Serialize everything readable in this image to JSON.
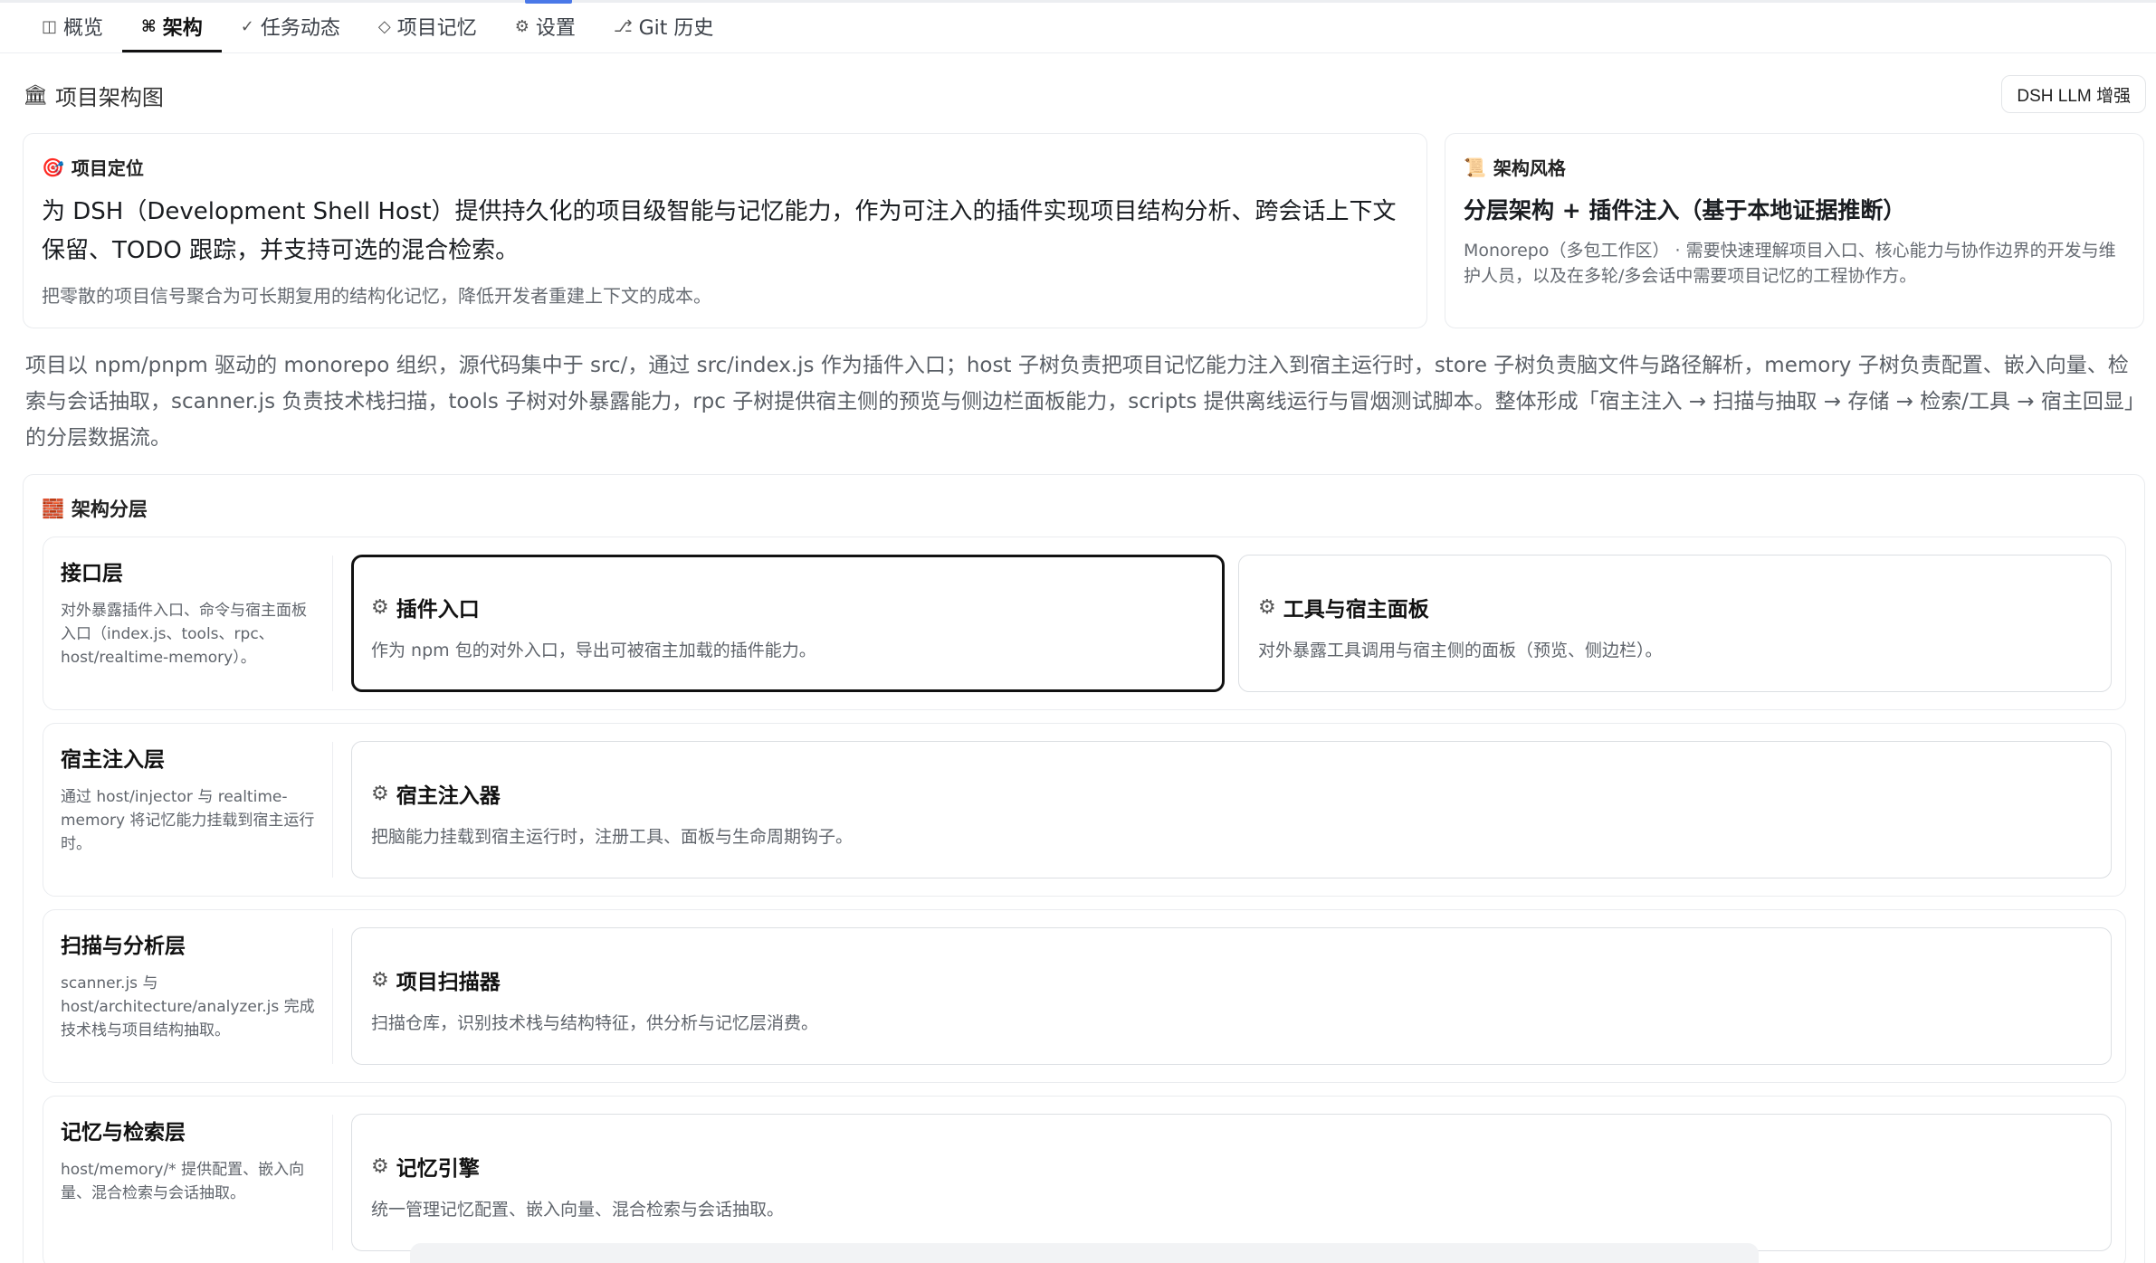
{
  "tabs": [
    {
      "icon": "◫",
      "label": "概览"
    },
    {
      "icon": "⌘",
      "label": "架构"
    },
    {
      "icon": "✓",
      "label": "任务动态"
    },
    {
      "icon": "◇",
      "label": "项目记忆"
    },
    {
      "icon": "⚙",
      "label": "设置"
    },
    {
      "icon": "⎇",
      "label": "Git 历史"
    }
  ],
  "section": {
    "icon": "🏛",
    "title": "项目架构图",
    "llm_button": "DSH LLM 增强"
  },
  "positioning": {
    "icon": "🎯",
    "title": "项目定位",
    "headline": "为 DSH（Development Shell Host）提供持久化的项目级智能与记忆能力，作为可注入的插件实现项目结构分析、跨会话上下文保留、TODO 跟踪，并支持可选的混合检索。",
    "sub": "把零散的项目信号聚合为可长期复用的结构化记忆，降低开发者重建上下文的成本。"
  },
  "style": {
    "icon": "📜",
    "title": "架构风格",
    "headline": "分层架构 + 插件注入（基于本地证据推断）",
    "sub": "Monorepo（多包工作区） · 需要快速理解项目入口、核心能力与协作边界的开发与维护人员，以及在多轮/多会话中需要项目记忆的工程协作方。"
  },
  "summary": "项目以 npm/pnpm 驱动的 monorepo 组织，源代码集中于 src/，通过 src/index.js 作为插件入口；host 子树负责把项目记忆能力注入到宿主运行时，store 子树负责脑文件与路径解析，memory 子树负责配置、嵌入向量、检索与会话抽取，scanner.js 负责技术栈扫描，tools 子树对外暴露能力，rpc 子树提供宿主侧的预览与侧边栏面板能力，scripts 提供离线运行与冒烟测试脚本。整体形成「宿主注入 → 扫描与抽取 → 存储 → 检索/工具 → 宿主回显」的分层数据流。",
  "layers_section": {
    "icon": "🧱",
    "title": "架构分层"
  },
  "layers": [
    {
      "name": "接口层",
      "desc": "对外暴露插件入口、命令与宿主面板入口（index.js、tools、rpc、host/realtime-memory）。",
      "components": [
        {
          "icon": "⚙",
          "name": "插件入口",
          "desc": "作为 npm 包的对外入口，导出可被宿主加载的插件能力。"
        },
        {
          "icon": "⚙",
          "name": "工具与宿主面板",
          "desc": "对外暴露工具调用与宿主侧的面板（预览、侧边栏）。"
        }
      ]
    },
    {
      "name": "宿主注入层",
      "desc": "通过 host/injector 与 realtime-memory 将记忆能力挂载到宿主运行时。",
      "components": [
        {
          "icon": "⚙",
          "name": "宿主注入器",
          "desc": "把脑能力挂载到宿主运行时，注册工具、面板与生命周期钩子。"
        }
      ]
    },
    {
      "name": "扫描与分析层",
      "desc": "scanner.js 与 host/architecture/analyzer.js 完成技术栈与项目结构抽取。",
      "components": [
        {
          "icon": "⚙",
          "name": "项目扫描器",
          "desc": "扫描仓库，识别技术栈与结构特征，供分析与记忆层消费。"
        }
      ]
    },
    {
      "name": "记忆与检索层",
      "desc": "host/memory/* 提供配置、嵌入向量、混合检索与会话抽取。",
      "components": [
        {
          "icon": "⚙",
          "name": "记忆引擎",
          "desc": "统一管理记忆配置、嵌入向量、混合检索与会话抽取。"
        }
      ]
    }
  ]
}
